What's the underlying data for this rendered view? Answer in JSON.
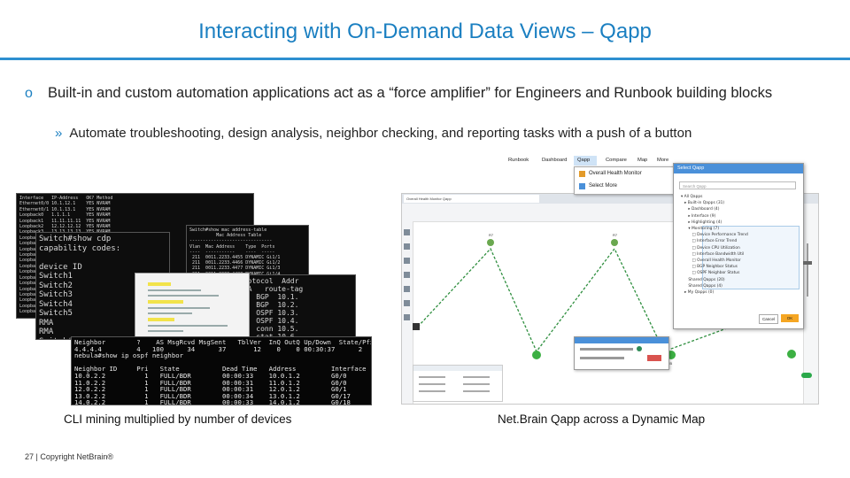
{
  "slide": {
    "title": "Interacting with On-Demand Data Views – Qapp",
    "bullet_marker": "o",
    "bullet_main": "Built-in and custom automation applications act as a “force amplifier” for Engineers and Runbook building blocks",
    "sub_marker": "»",
    "bullet_sub": "Automate troubleshooting, design analysis, neighbor checking, and reporting tasks with a push of a button",
    "caption_left": "CLI mining multiplied by number of devices",
    "caption_right": "Net.Brain Qapp across a Dynamic Map",
    "footer": "27 | Copyright NetBrain®"
  },
  "cli": {
    "t1": "Interface   IP-Address   OK? Method\nEthernet0/0 10.1.12.1    YES NVRAM\nEthernet0/1 10.1.13.1    YES NVRAM\nLoopback0   1.1.1.1      YES NVRAM\nLoopback1   11.11.11.11  YES NVRAM\nLoopback2   12.12.12.12  YES NVRAM\nLoopback3   13.13.13.13  YES NVRAM\nLoopback4   14.14.14.14  YES NVRAM\nLoopback5   15.15.15.15  YES NVRAM\nLoopback6   16.16.16.16  YES NVRAM\nLoopback7   17.17.17.17  YES NVRAM\nLoopback8   18.18.18.18  YES NVRAM\nLoopback9   19.19.19.19  YES NVRAM\nLoopback10  20.20.20.20  YES NVRAM\nLoopback11  21.21.21.21  YES NVRAM\nLoopback12  22.22.22.22  YES NVRAM\nLoopback13  23.23.23.23  YES NVRAM\nLoopback14  24.24.24.24  YES NVRAM\nLoopback15  25.25.25.25  YES NVRAM\nLoopback16  26.26.26.26  YES NVRAM\nLoopback17  27.27.27.27  YES NVRAM",
    "t2": "Switch#show mac address-table\n          Mac Address Table\n-------------------------------\nVlan  Mac Address    Type  Ports\n----  -----------    ----  -----\n 211  0011.2233.4455 DYNAMIC Gi1/1\n 211  0011.2233.4466 DYNAMIC Gi1/2\n 211  0011.2233.4477 DYNAMIC Gi1/3\n 211  0011.2233.4488 DYNAMIC Gi1/4\n 211  0011.2233.4499 DYNAMIC Gi1/5\n 211  0011.2233.44aa DYNAMIC Gi1/6\n 211  0011.2233.44bb DYNAMIC Gi1/7\n 211  0011.2233.44cc DYNAMIC Gi1/8\n 211  0011.2233.44dd DYNAMIC Gi1/9\n 211  0011.2233.44ee DYNAMIC Gi1/10\n 211  0011.2233.44ff DYNAMIC Gi1/11\n 211  0011.2233.4500 DYNAMIC Gi1/12\n 211  0011.2233.4511 DYNAMIC Gi1/13",
    "t3": "Switch#show cdp\ncapability codes:\n\ndevice ID\nSwitch1\nSwitch2\nSwitch3\nSwitch4\nSwitch5\nRMA\nRMA\nSwitch#",
    "t6": "Protocol  Addr\nSMA   route-tag\nB   BGP  10.1.\nB   BGP  10.2.\nO   OSPF 10.3.\nO   OSPF 10.4.\nC   conn 10.5.\nS   stat 10.6.\nBGP route-tag\nBGP filter-list\nBGP activity 8/0",
    "t5": "Neighbor        ?    AS MsgRcvd MsgSent   TblVer  InQ OutQ Up/Down  State/PfxRcd\n4.4.4.4         4   100      34      37       12    0    0 00:30:37      2\nnebula#show ip ospf neighbor\n\nNeighbor ID     Pri   State           Dead Time   Address         Interface  Area\n10.0.2.2          1   FULL/BDR        00:00:33    10.0.1.2        G0/0        1\n11.0.2.2          1   FULL/BDR        00:00:31    11.0.1.2        G0/0        1\n12.0.2.2          1   FULL/BDR        00:00:31    12.0.1.2        G0/1        0\n13.0.2.2          1   FULL/BDR        00:00:34    13.0.1.2        G0/17       0\n14.0.2.2          1   FULL/BDR        00:00:33    14.0.1.2        G0/18       0\nnebula#"
  },
  "map": {
    "nav_items": [
      "Runbook",
      "Dashboard",
      "Qapp",
      "Compare",
      "Map",
      "More"
    ],
    "dropdown_items": [
      "Overall Health Monitor",
      "Select More"
    ],
    "panel_title": "Select Qapp",
    "panel_search": "Search Qapp",
    "panel_tree": "▾ All Qapps\n   ▸ Built-in Qapps (31)\n      ▸ Dashboard (4)\n      ▸ Interface (9)\n      ▸ Highlighting (4)\n      ▾ Monitoring (7)\n         □ Device Performance Trend\n         □ Interface Error Trend\n         □ Device CPU Utilization\n         □ Interface Bandwidth Util\n         □ Overall Health Monitor\n         □ BGP Neighbor Status\n         □ OSPF Neighbor Status\n      Shared Qapps (20)\n      Shared Qapps (4)\n   ▸ My Qapps (0)",
    "btn_cancel": "Cancel",
    "btn_ok": "OK",
    "tab_label": "Overall Health Monitor Qapp",
    "node_labels": [
      "R7",
      "R7",
      "R5"
    ]
  }
}
